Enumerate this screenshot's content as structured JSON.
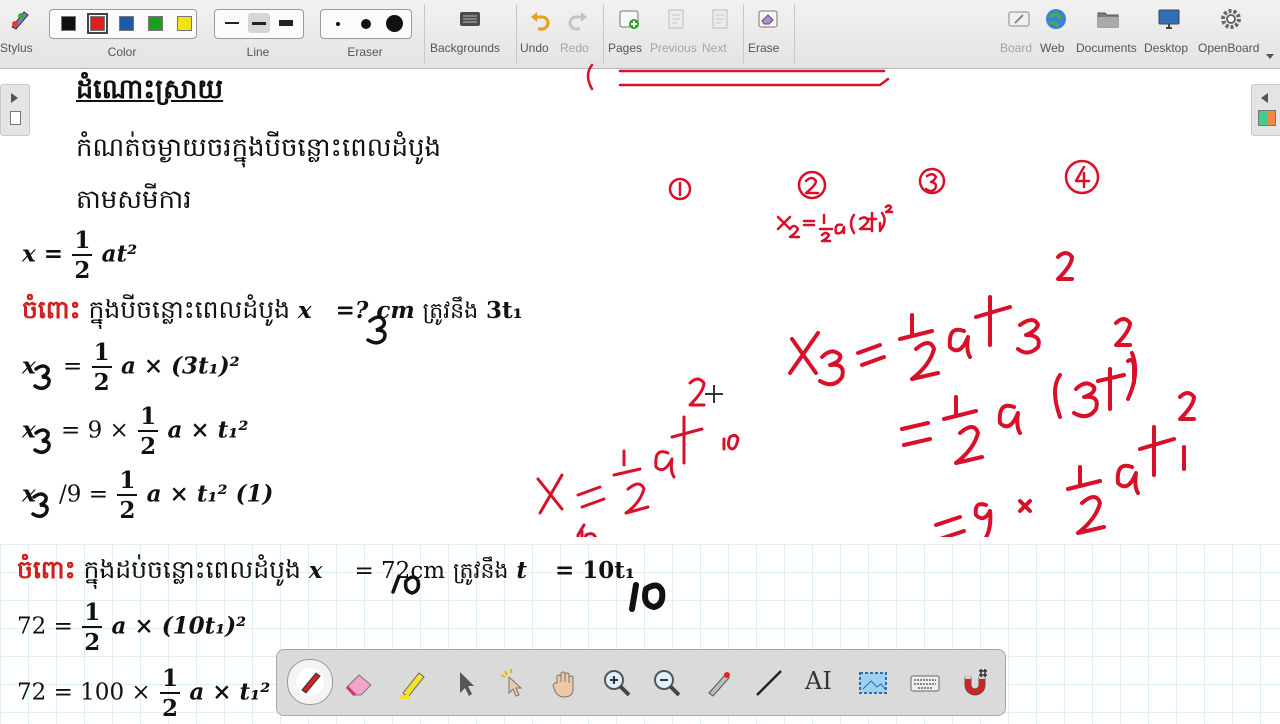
{
  "toolbar": {
    "stylus_label": "Stylus",
    "color_label": "Color",
    "line_label": "Line",
    "eraser_label": "Eraser",
    "colors": [
      "#111111",
      "#e01e1e",
      "#1f5aa6",
      "#18a020",
      "#f2e21a"
    ],
    "selected_color": "#e01e1e",
    "backgrounds_label": "Backgrounds",
    "undo_label": "Undo",
    "redo_label": "Redo",
    "pages_label": "Pages",
    "previous_label": "Previous",
    "next_label": "Next",
    "erase_label": "Erase",
    "board_label": "Board",
    "web_label": "Web",
    "documents_label": "Documents",
    "desktop_label": "Desktop",
    "openboard_label": "OpenBoard"
  },
  "doc": {
    "heading": "ដំណោះស្រាយ",
    "intro_line1": "កំណត់ចម្ងាយចរក្នុងបីចន្លោះពេលដំបូង",
    "intro_line2": "តាមសមីការ",
    "formula": {
      "lhs": "x =",
      "num": "1",
      "den": "2",
      "rhs": "at²"
    },
    "case1": {
      "prefix": "ចំពោះ",
      "text": "ក្នុងបីចន្លោះពេលដំបូង",
      "var": "x",
      "mid": "=? cm",
      "equiv": "ត្រូវនឹង",
      "time": "3t₁"
    },
    "steps1": [
      {
        "lhs": "x",
        "pre": "=",
        "num": "1",
        "den": "2",
        "post": "a × (3t₁)²"
      },
      {
        "lhs": "x",
        "pre": "= 9 ×",
        "num": "1",
        "den": "2",
        "post": "a × t₁²"
      },
      {
        "lhs": "x",
        "pre": "/9 =",
        "num": "1",
        "den": "2",
        "post": "a × t₁²   (1)"
      }
    ],
    "case2": {
      "prefix": "ចំពោះ",
      "text": "ក្នុងដប់ចន្លោះពេលដំបូង",
      "var": "x",
      "mid": "= 72cm",
      "equiv": "ត្រូវនឹង",
      "tvar": "t",
      "time": "= 10t₁"
    },
    "steps2": [
      {
        "lhs": "72",
        "pre": "=",
        "num": "1",
        "den": "2",
        "post": "a × (10t₁)²"
      },
      {
        "lhs": "72",
        "pre": "= 100 ×",
        "num": "1",
        "den": "2",
        "post": "a × t₁²"
      }
    ]
  },
  "annotations": {
    "ink_color": "#d8102a",
    "pen_color": "#111111",
    "labels": [
      "1",
      "2",
      "3",
      "4"
    ],
    "top_note": "x₂ = ½ a(2t₁)²",
    "main_eq": [
      "x₃ = ½ a t₃²",
      "= ½ a (3t₁)²",
      "= 9 × ½ a t₁²"
    ],
    "side_eq": "x₁₀ = ½ a t₁₀²",
    "overwrite_subscripts": [
      "3",
      "3",
      "3",
      "3",
      "10",
      "10"
    ]
  },
  "palette": {
    "tools": [
      "pen-icon",
      "eraser-icon",
      "marker-icon",
      "selector-icon",
      "interact-icon",
      "hand-icon",
      "zoom-in-icon",
      "zoom-out-icon",
      "laser-pointer-icon",
      "line-icon",
      "text-icon",
      "capture-icon",
      "keyboard-icon",
      "magnet-icon"
    ],
    "selected": "pen-icon",
    "text_tool_glyph": "AI"
  }
}
